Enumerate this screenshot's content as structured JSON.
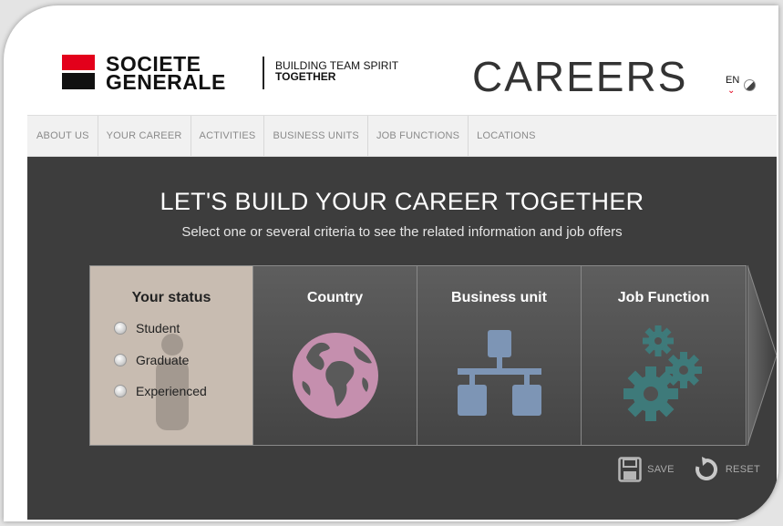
{
  "header": {
    "brand_line1": "SOCIETE",
    "brand_line2": "GENERALE",
    "tagline_line1": "BUILDING TEAM SPIRIT",
    "tagline_line2": "TOGETHER",
    "site_title": "CAREERS",
    "language": "EN",
    "language_caret": "⌄"
  },
  "nav": {
    "items": [
      {
        "label": "ABOUT US"
      },
      {
        "label": "YOUR CAREER"
      },
      {
        "label": "ACTIVITIES"
      },
      {
        "label": "BUSINESS UNITS"
      },
      {
        "label": "JOB FUNCTIONS"
      },
      {
        "label": "LOCATIONS"
      }
    ]
  },
  "hero": {
    "title": "LET'S BUILD YOUR CAREER TOGETHER",
    "subtitle": "Select one or several criteria to see the related information and job offers"
  },
  "criteria": {
    "status": {
      "title": "Your status",
      "options": [
        {
          "label": "Student"
        },
        {
          "label": "Graduate"
        },
        {
          "label": "Experienced"
        }
      ]
    },
    "country": {
      "title": "Country",
      "icon": "globe-icon"
    },
    "business_unit": {
      "title": "Business unit",
      "icon": "org-chart-icon"
    },
    "job_function": {
      "title": "Job Function",
      "icon": "gears-icon"
    }
  },
  "actions": {
    "save_label": "SAVE",
    "reset_label": "RESET"
  },
  "colors": {
    "brand_red": "#e3001b",
    "main_bg": "#3d3d3d",
    "status_panel": "#c8bcb1",
    "globe": "#c58fae",
    "org_chart": "#7d95b5",
    "gears": "#3e7a7a"
  }
}
